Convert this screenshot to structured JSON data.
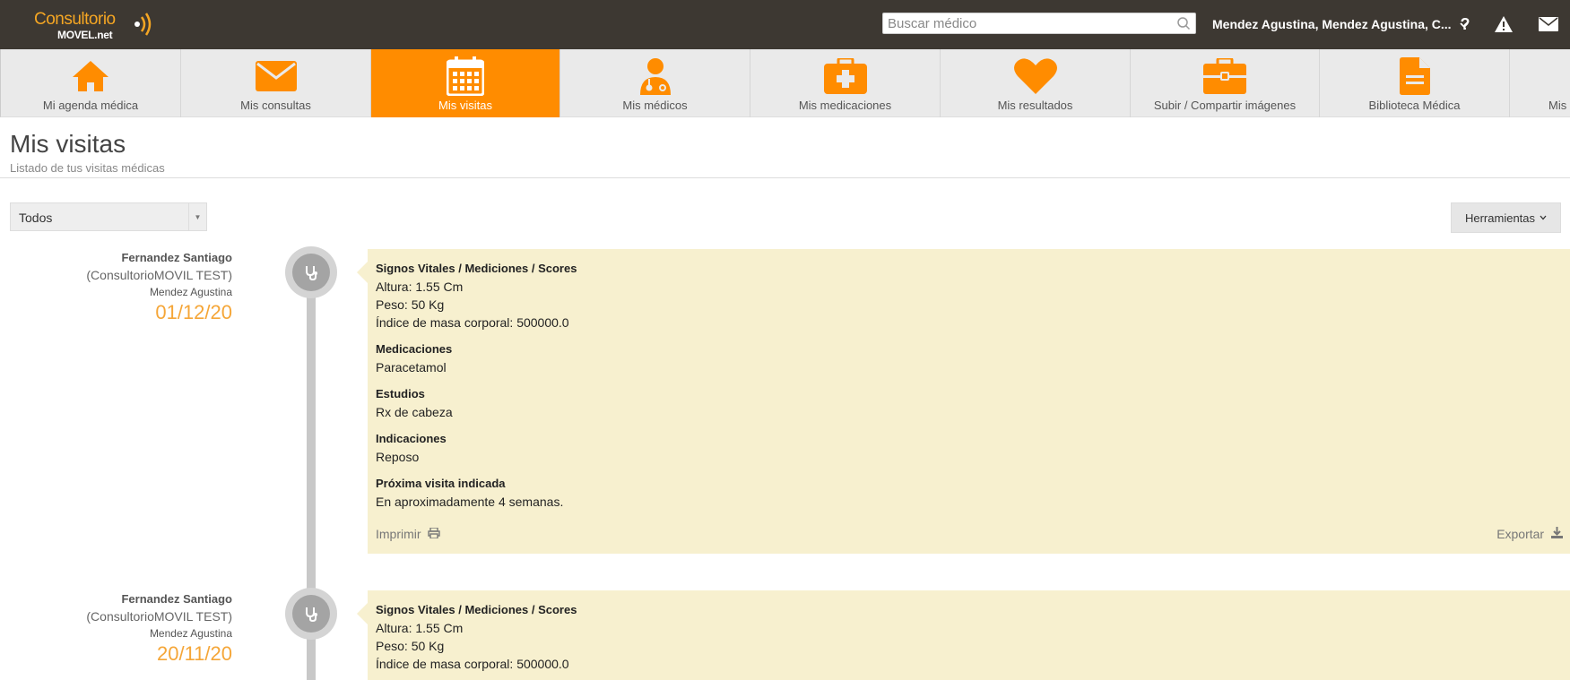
{
  "header": {
    "logo_text": "Consultorio",
    "logo_subtext": "MOVEL.net",
    "search_placeholder": "Buscar médico",
    "user_label": "Mendez Agustina, Mendez Agustina, C...",
    "help_icon": "question-icon",
    "alert_icon": "warning-icon",
    "mail_icon": "envelope-icon",
    "bg_color": "#3d3832"
  },
  "nav": {
    "active_color": "#ff8c00",
    "items": [
      {
        "label": "Mi agenda médica",
        "icon": "home-icon"
      },
      {
        "label": "Mis consultas",
        "icon": "envelope-icon"
      },
      {
        "label": "Mis visitas",
        "icon": "calendar-icon",
        "active": true
      },
      {
        "label": "Mis médicos",
        "icon": "doctor-icon"
      },
      {
        "label": "Mis medicaciones",
        "icon": "first-aid-kit-icon"
      },
      {
        "label": "Mis resultados",
        "icon": "heart-icon"
      },
      {
        "label": "Subir / Compartir imágenes",
        "icon": "briefcase-icon"
      },
      {
        "label": "Biblioteca Médica",
        "icon": "document-icon"
      },
      {
        "label": "Mis",
        "icon": ""
      }
    ]
  },
  "page": {
    "title": "Mis visitas",
    "subtitle": "Listado de tus visitas médicas"
  },
  "filter": {
    "selected": "Todos"
  },
  "tools": {
    "label": "Herramientas"
  },
  "visits": [
    {
      "doctor": "Fernandez Santiago",
      "clinic": "(ConsultorioMOVIL TEST)",
      "patient": "Mendez Agustina",
      "date": "01/12/20",
      "sections": [
        {
          "title": "Signos Vitales / Mediciones / Scores",
          "lines": [
            "Altura: 1.55 Cm",
            "Peso: 50 Kg",
            "Índice de masa corporal: 500000.0"
          ]
        },
        {
          "title": "Medicaciones",
          "lines": [
            "Paracetamol"
          ]
        },
        {
          "title": "Estudios",
          "lines": [
            "Rx de cabeza"
          ]
        },
        {
          "title": "Indicaciones",
          "lines": [
            "Reposo"
          ]
        },
        {
          "title": "Próxima visita indicada",
          "lines": [
            "En aproximadamente 4 semanas."
          ]
        }
      ],
      "print_label": "Imprimir",
      "export_label": "Exportar"
    },
    {
      "doctor": "Fernandez Santiago",
      "clinic": "(ConsultorioMOVIL TEST)",
      "patient": "Mendez Agustina",
      "date": "20/11/20",
      "sections": [
        {
          "title": "Signos Vitales / Mediciones / Scores",
          "lines": [
            "Altura: 1.55 Cm",
            "Peso: 50 Kg",
            "Índice de masa corporal: 500000.0"
          ]
        }
      ]
    }
  ]
}
